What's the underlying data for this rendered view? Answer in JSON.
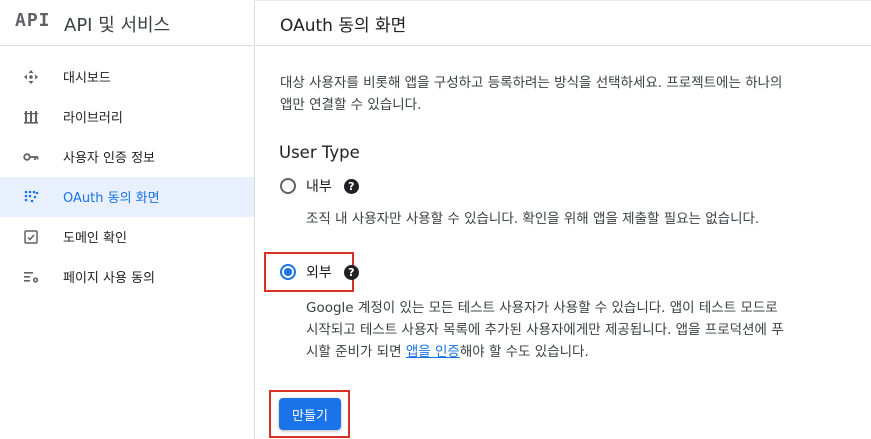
{
  "brand": {
    "logo": "API",
    "title": "API 및 서비스"
  },
  "sidebar": {
    "items": [
      {
        "label": "대시보드",
        "icon": "dashboard-icon",
        "active": false
      },
      {
        "label": "라이브러리",
        "icon": "library-icon",
        "active": false
      },
      {
        "label": "사용자 인증 정보",
        "icon": "key-icon",
        "active": false
      },
      {
        "label": "OAuth 동의 화면",
        "icon": "consent-icon",
        "active": true
      },
      {
        "label": "도메인 확인",
        "icon": "domain-check-icon",
        "active": false
      },
      {
        "label": "페이지 사용 동의",
        "icon": "settings-list-icon",
        "active": false
      }
    ]
  },
  "main": {
    "title": "OAuth 동의 화면",
    "description": "대상 사용자를 비롯해 앱을 구성하고 등록하려는 방식을 선택하세요. 프로젝트에는 하나의 앱만 연결할 수 있습니다.",
    "user_type_heading": "User Type",
    "options": {
      "internal": {
        "label": "내부",
        "selected": false,
        "description": "조직 내 사용자만 사용할 수 있습니다. 확인을 위해 앱을 제출할 필요는 없습니다."
      },
      "external": {
        "label": "외부",
        "selected": true,
        "description_before": "Google 계정이 있는 모든 테스트 사용자가 사용할 수 있습니다. 앱이 테스트 모드로 시작되고 테스트 사용자 목록에 추가된 사용자에게만 제공됩니다. 앱을 프로덕션에 푸시할 준비가 되면 ",
        "description_link": "앱을 인증",
        "description_after": "해야 할 수도 있습니다."
      }
    },
    "help_glyph": "?",
    "create_button": "만들기"
  },
  "colors": {
    "accent": "#1a73e8",
    "highlight_box": "#d93025",
    "active_bg": "#e8f0fe"
  }
}
